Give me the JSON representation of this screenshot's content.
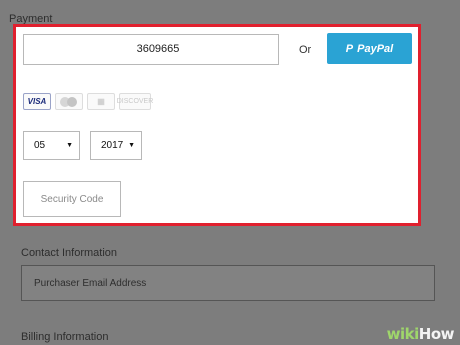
{
  "payment": {
    "section_title": "Payment",
    "card_number": "3609665",
    "or_text": "Or",
    "paypal_label": "PayPal",
    "card_logos": [
      "VISA",
      "MasterCard",
      "AMEX",
      "DISCOVER"
    ],
    "month": "05",
    "year": "2017",
    "security_placeholder": "Security Code"
  },
  "contact": {
    "section_title": "Contact Information",
    "email_placeholder": "Purchaser Email Address"
  },
  "billing": {
    "section_title": "Billing Information"
  },
  "watermark": {
    "part1": "wiki",
    "part2": "How"
  },
  "colors": {
    "highlight_border": "#e0202e",
    "paypal": "#2aa3d4",
    "overlay": "#7d7d7d"
  }
}
